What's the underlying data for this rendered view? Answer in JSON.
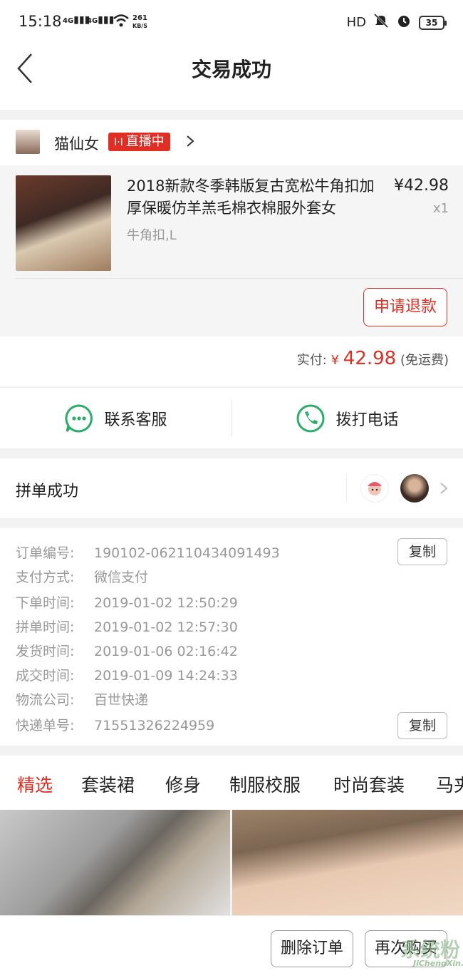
{
  "status_bar": {
    "time": "15:18",
    "net1": "4G",
    "net2": "4G",
    "speed_value": "261",
    "speed_unit": "KB/S",
    "hd": "HD",
    "battery": "35"
  },
  "header": {
    "title": "交易成功"
  },
  "shop": {
    "name": "猫仙女",
    "live_badge": "直播中"
  },
  "product": {
    "title": "2018新款冬季韩版复古宽松牛角扣加厚保暖仿羊羔毛棉衣棉服外套女",
    "price": "¥42.98",
    "quantity": "x1",
    "spec": "牛角扣,L",
    "refund_button": "申请退款"
  },
  "payment": {
    "label": "实付:",
    "currency": "¥",
    "amount": "42.98",
    "note": "(免运费)"
  },
  "contact": {
    "service_label": "联系客服",
    "phone_label": "拨打电话"
  },
  "group": {
    "label": "拼单成功"
  },
  "order_info": {
    "rows": [
      {
        "key": "订单编号:",
        "value": "190102-062110434091493"
      },
      {
        "key": "支付方式:",
        "value": "微信支付"
      },
      {
        "key": "下单时间:",
        "value": "2019-01-02 12:50:29"
      },
      {
        "key": "拼单时间:",
        "value": "2019-01-02 12:57:30"
      },
      {
        "key": "发货时间:",
        "value": "2019-01-06 02:16:42"
      },
      {
        "key": "成交时间:",
        "value": "2019-01-09 14:24:33"
      },
      {
        "key": "物流公司:",
        "value": "百世快递"
      },
      {
        "key": "快递单号:",
        "value": "71551326224959"
      }
    ],
    "copy_label": "复制"
  },
  "tabs": [
    "精选",
    "套装裙",
    "修身",
    "制服校服",
    "时尚套装",
    "马夹"
  ],
  "bottom": {
    "delete_button": "删除订单",
    "rebuy_button": "再次购买",
    "watermark": "系统粉",
    "watermark_url": "JiChengXin.com"
  },
  "colors": {
    "accent": "#e02e24",
    "contact_green": "#2aae67",
    "muted": "#999999"
  }
}
